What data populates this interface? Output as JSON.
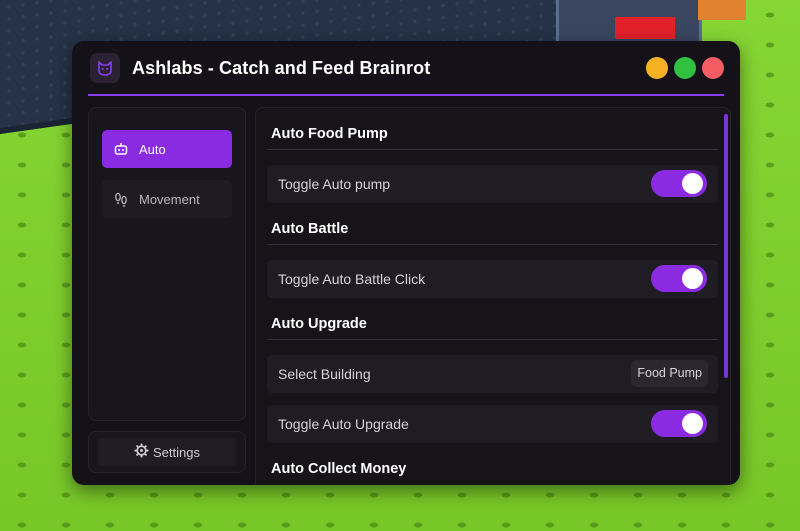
{
  "app": {
    "title": "Ashlabs - Catch and Feed Brainrot",
    "logo_icon": "cat-icon",
    "window_controls": [
      "minimize",
      "maximize",
      "close"
    ]
  },
  "colors": {
    "accent": "#8a2be2",
    "window_bg": "#141218",
    "minimize": "#f5b324",
    "maximize": "#2fc13f",
    "close": "#f25c63"
  },
  "sidebar": {
    "items": [
      {
        "label": "Auto",
        "icon": "robot-icon",
        "active": true
      },
      {
        "label": "Movement",
        "icon": "footprints-icon",
        "active": false
      }
    ],
    "settings": {
      "label": "Settings",
      "icon": "gear-icon"
    }
  },
  "content": {
    "sections": [
      {
        "title": "Auto Food Pump",
        "rows": [
          {
            "type": "toggle",
            "label": "Toggle Auto pump",
            "on": true
          }
        ]
      },
      {
        "title": "Auto Battle",
        "rows": [
          {
            "type": "toggle",
            "label": "Toggle Auto Battle Click",
            "on": true
          }
        ]
      },
      {
        "title": "Auto Upgrade",
        "rows": [
          {
            "type": "dropdown",
            "label": "Select Building",
            "value": "Food Pump"
          },
          {
            "type": "toggle",
            "label": "Toggle Auto Upgrade",
            "on": true
          }
        ]
      },
      {
        "title": "Auto Collect Money",
        "rows": []
      }
    ]
  }
}
